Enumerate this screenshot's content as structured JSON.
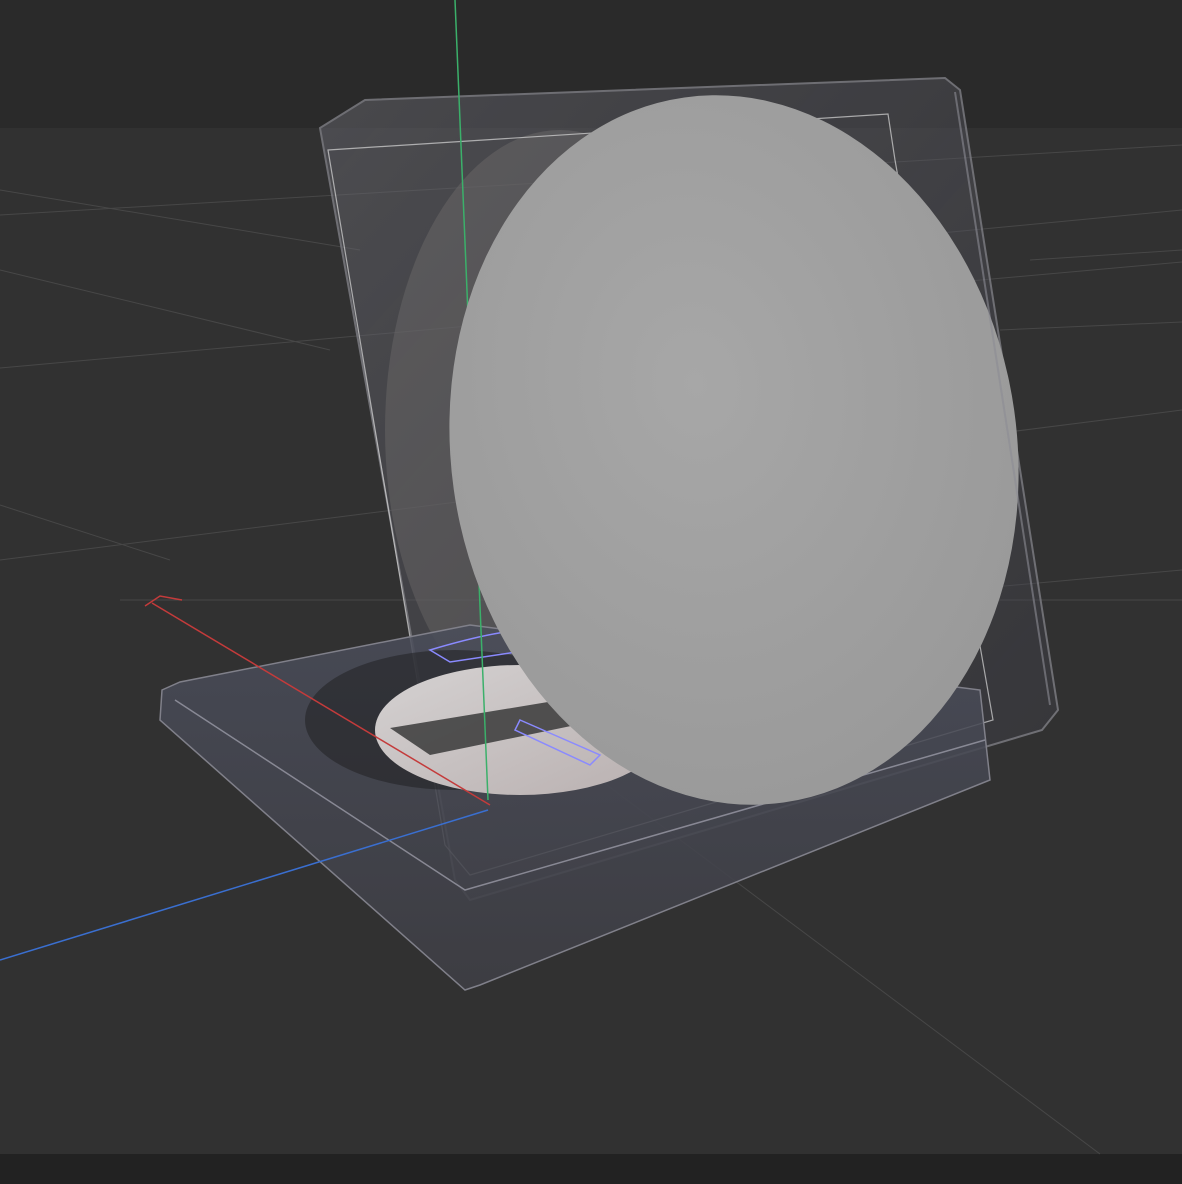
{
  "app": {
    "name": "3d-viewport"
  },
  "colors": {
    "header_bg": "#2a2a2a",
    "viewport_bg": "#313131",
    "footer_bg": "#222222",
    "grid_line": "#4a4a4a",
    "axis_x": "#c43b3b",
    "axis_y": "#3bb06a",
    "axis_z": "#3a6fd0",
    "sphere_fill": "#9e9e9e",
    "selection_outline": "#8a8aff"
  },
  "scene": {
    "objects": [
      "display-case",
      "front-disc",
      "stand-base",
      "back-disc",
      "hinge-selection"
    ]
  }
}
